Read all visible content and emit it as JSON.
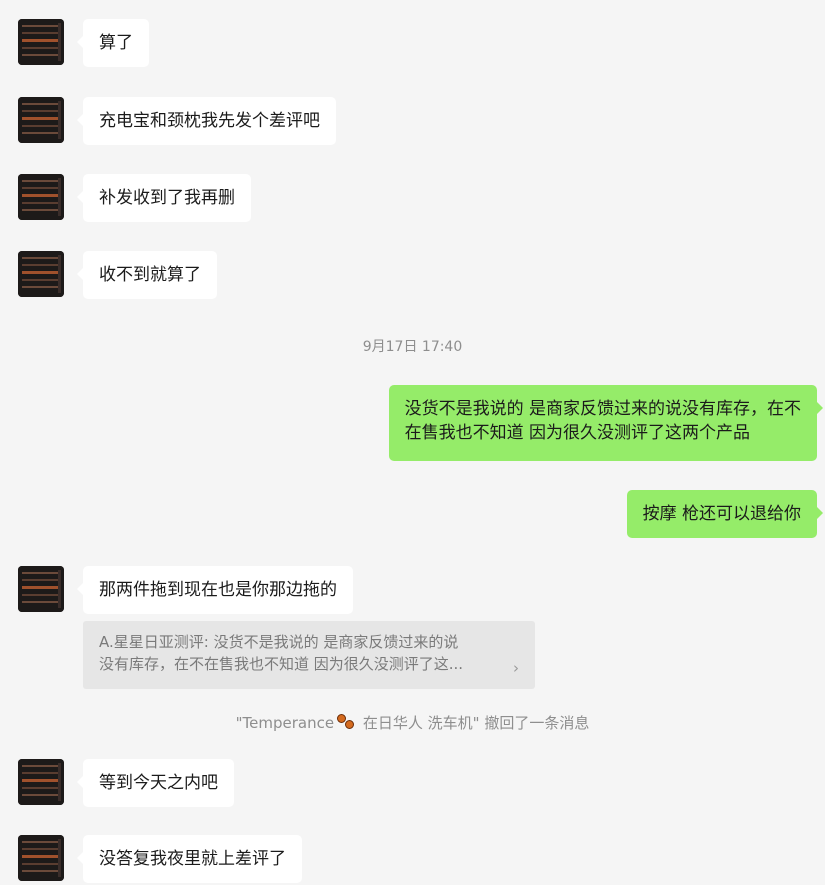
{
  "messages": [
    {
      "side": "in",
      "lines": [
        "算了"
      ]
    },
    {
      "side": "in",
      "lines": [
        "充电宝和颈枕我先发个差评吧"
      ]
    },
    {
      "side": "in",
      "lines": [
        "补发收到了我再删"
      ]
    },
    {
      "side": "in",
      "lines": [
        "收不到就算了"
      ]
    },
    {
      "side": "out",
      "lines": [
        "没货不是我说的 是商家反馈过来的说没有库存，在不",
        "在售我也不知道 因为很久没测评了这两个产品"
      ]
    },
    {
      "side": "out",
      "lines": [
        "按摩 枪还可以退给你"
      ]
    },
    {
      "side": "in",
      "lines": [
        "那两件拖到现在也是你那边拖的"
      ]
    },
    {
      "side": "in",
      "lines": [
        "等到今天之内吧"
      ]
    },
    {
      "side": "in",
      "lines": [
        "没答复我夜里就上差评了"
      ]
    }
  ],
  "timestamp": "9月17日 17:40",
  "quote": {
    "line1": "A.星星日亚测评: 没货不是我说的 是商家反馈过来的说",
    "line2": "没有库存，在不在售我也不知道 因为很久没测评了这...",
    "chevron": "›"
  },
  "system_notice": {
    "before": "\"Temperance",
    "after": " 在日华人 洗车机\" 撤回了一条消息",
    "emoji": "paw-emoji"
  },
  "colors": {
    "background": "#f5f5f5",
    "incoming_bubble": "#ffffff",
    "outgoing_bubble": "#95ec69",
    "quote_bg": "#e6e6e6",
    "meta_text": "#8e8e8e"
  }
}
